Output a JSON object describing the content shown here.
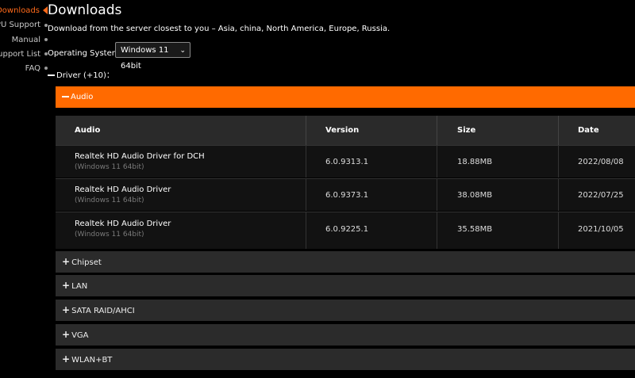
{
  "sidebar": {
    "items": [
      {
        "label": "Downloads",
        "active": true
      },
      {
        "label": "CPU Support",
        "active": false
      },
      {
        "label": "Manual",
        "active": false
      },
      {
        "label": "Support List",
        "active": false
      },
      {
        "label": "FAQ",
        "active": false
      }
    ]
  },
  "main": {
    "title": "Downloads",
    "intro": "Download from the server closest to you – Asia, china, North America, Europe, Russia.",
    "os_label": "Operating System：",
    "os_selected": "Windows 11 64bit",
    "driver_heading": "Driver (+10)："
  },
  "categories": [
    {
      "label": "Audio",
      "expanded": true
    },
    {
      "label": "Chipset",
      "expanded": false
    },
    {
      "label": "LAN",
      "expanded": false
    },
    {
      "label": "SATA RAID/AHCI",
      "expanded": false
    },
    {
      "label": "VGA",
      "expanded": false
    },
    {
      "label": "WLAN+BT",
      "expanded": false
    }
  ],
  "audio_table": {
    "columns": [
      "Audio",
      "Version",
      "Size",
      "Date"
    ],
    "rows": [
      {
        "name": "Realtek HD Audio Driver for DCH",
        "os": "(Windows 11 64bit)",
        "version": "6.0.9313.1",
        "size": "18.88MB",
        "date": "2022/08/08"
      },
      {
        "name": "Realtek HD Audio Driver",
        "os": "(Windows 11 64bit)",
        "version": "6.0.9373.1",
        "size": "38.08MB",
        "date": "2022/07/25"
      },
      {
        "name": "Realtek HD Audio Driver",
        "os": "(Windows 11 64bit)",
        "version": "6.0.9225.1",
        "size": "35.58MB",
        "date": "2021/10/05"
      }
    ]
  },
  "colors": {
    "accent": "#ff6a00",
    "background": "#000000",
    "bar": "#2b2b2b"
  }
}
